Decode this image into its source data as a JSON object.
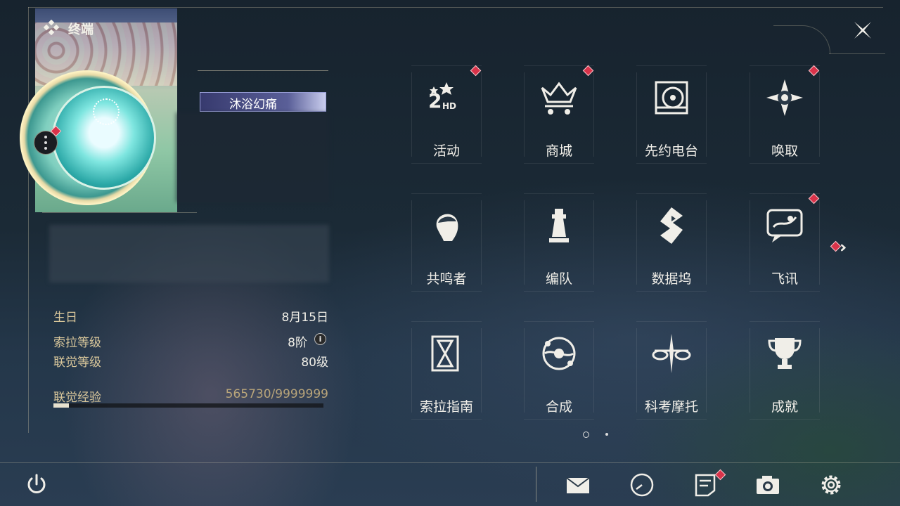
{
  "header": {
    "title": "终端"
  },
  "profile": {
    "name": "沐浴幻痛"
  },
  "stats": {
    "birthday": {
      "label": "生日",
      "value": "8月15日"
    },
    "sola_level": {
      "label": "索拉等级",
      "value": "8阶"
    },
    "union_level": {
      "label": "联觉等级",
      "value": "80级"
    },
    "union_exp": {
      "label": "联觉经验",
      "value": "565730/9999999",
      "progress": 0.0566
    }
  },
  "menu": {
    "items": [
      {
        "label": "活动",
        "icon": "event-2hd-icon",
        "badge": true
      },
      {
        "label": "商城",
        "icon": "shop-crown-cart-icon",
        "badge": true
      },
      {
        "label": "先约电台",
        "icon": "radio-record-icon",
        "badge": false
      },
      {
        "label": "唤取",
        "icon": "convene-compass-icon",
        "badge": true
      },
      {
        "label": "共鸣者",
        "icon": "resonator-head-icon",
        "badge": false
      },
      {
        "label": "编队",
        "icon": "team-chess-icon",
        "badge": false
      },
      {
        "label": "数据坞",
        "icon": "databank-icon",
        "badge": false
      },
      {
        "label": "飞讯",
        "icon": "messenger-chat-icon",
        "badge": true
      },
      {
        "label": "索拉指南",
        "icon": "guidebook-icon",
        "badge": false
      },
      {
        "label": "合成",
        "icon": "synthesis-orbit-icon",
        "badge": false
      },
      {
        "label": "科考摩托",
        "icon": "motorbike-icon",
        "badge": false
      },
      {
        "label": "成就",
        "icon": "trophy-icon",
        "badge": false
      }
    ]
  },
  "pager": {
    "pages": 2,
    "current": 1
  },
  "bottom_bar": {
    "icons": [
      "power-icon",
      "mail-icon",
      "clock-icon",
      "notice-icon",
      "camera-icon",
      "settings-gear-icon"
    ]
  },
  "colors": {
    "accent_gold": "#d9c79b",
    "badge_red": "#d9334a"
  }
}
